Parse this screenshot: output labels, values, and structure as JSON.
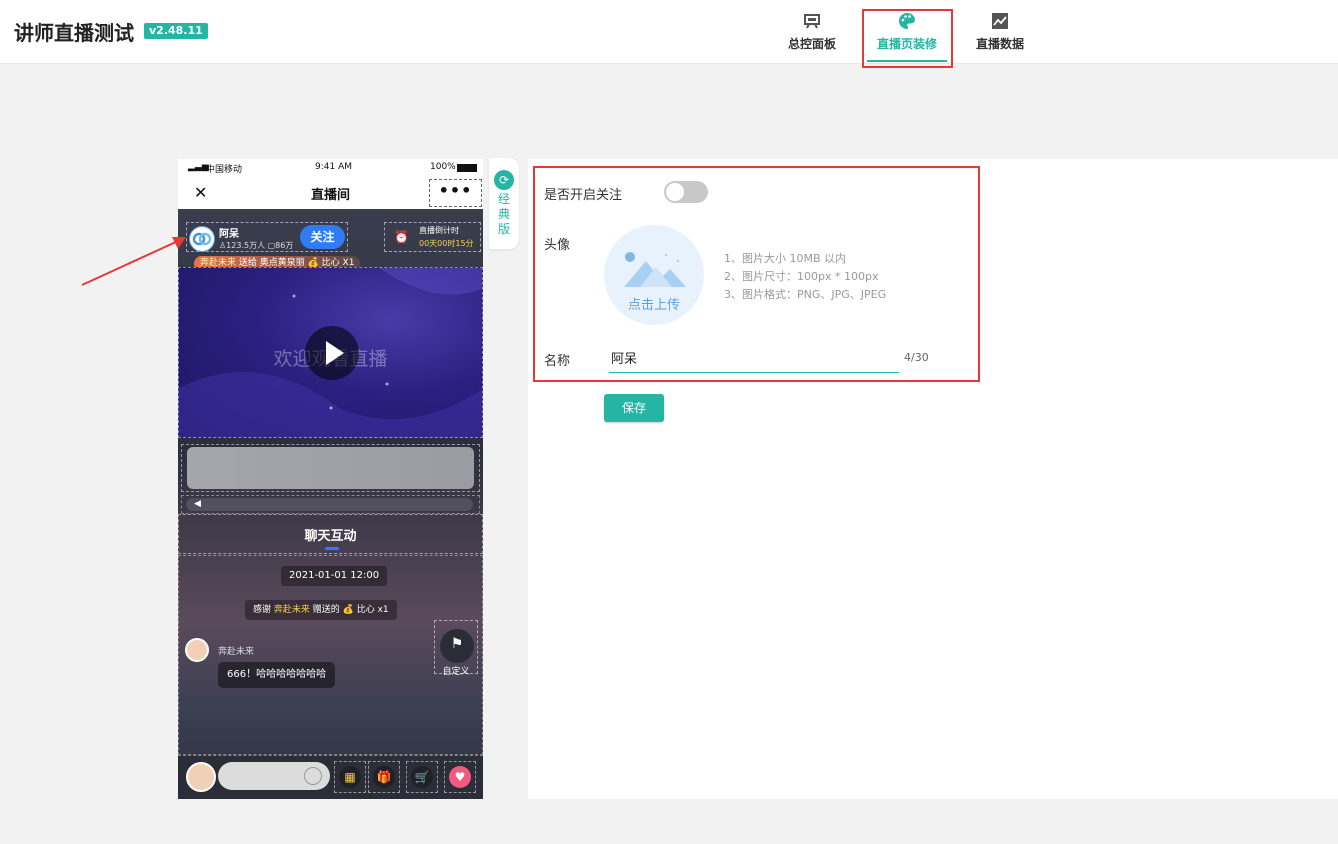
{
  "header": {
    "title": "讲师直播测试",
    "version": "v2.48.11",
    "tabs": [
      {
        "label": "总控面板",
        "icon": "presentation-board-icon"
      },
      {
        "label": "直播页装修",
        "icon": "palette-icon",
        "active": true
      },
      {
        "label": "直播数据",
        "icon": "line-chart-icon"
      }
    ]
  },
  "phone": {
    "status": {
      "carrier": "中国移动",
      "time": "9:41 AM",
      "battery": "100%"
    },
    "navbar": {
      "title": "直播间",
      "close": "✕",
      "more": "•••"
    },
    "host": {
      "name": "阿呆",
      "stats": "123.5万人 ▢86万",
      "follow": "关注"
    },
    "countdown": {
      "label": "直播倒计时",
      "value": "00天00时15分"
    },
    "gift_banner": {
      "name": "奔赴未来",
      "text": "送给 奥点黄泉丽 💰 比心 X1"
    },
    "video_text": "欢迎观看直播",
    "chat_tab": "聊天互动",
    "chat": {
      "time": "2021-01-01 12:00",
      "thanks_prefix": "感谢",
      "thanks_name": "奔赴未来",
      "thanks_suffix": "赠送的 💰 比心 x1",
      "msg_name": "奔赴未来",
      "msg_text": "666！哈哈哈哈哈哈哈",
      "custom_label": "自定义"
    }
  },
  "classic_tab": {
    "label": "经典版"
  },
  "form": {
    "follow_label": "是否开启关注",
    "follow_enabled": false,
    "avatar_label": "头像",
    "upload_label": "点击上传",
    "hints": [
      "1、图片大小 10MB 以内",
      "2、图片尺寸：100px * 100px",
      "3、图片格式：PNG、JPG、JPEG"
    ],
    "name_label": "名称",
    "name_value": "阿呆",
    "name_counter": "4/30",
    "save": "保存"
  },
  "colors": {
    "accent": "#25b5a5",
    "highlight": "#e53935",
    "follow": "#2e7cf6"
  }
}
